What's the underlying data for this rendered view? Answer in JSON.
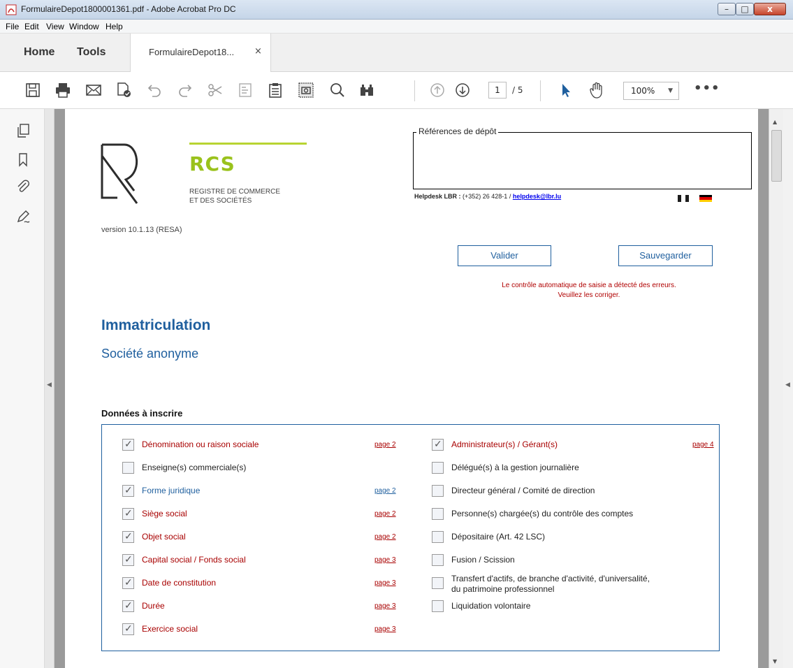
{
  "window": {
    "title": "FormulaireDepot1800001361.pdf - Adobe Acrobat Pro DC",
    "controls": {
      "minimize": "–",
      "maximize": "□",
      "close": "x"
    }
  },
  "menu": {
    "file": "File",
    "edit": "Edit",
    "view": "View",
    "window": "Window",
    "help": "Help"
  },
  "tabs": {
    "home": "Home",
    "tools": "Tools",
    "document": "FormulaireDepot18...",
    "close": "×"
  },
  "toolbar": {
    "icons": [
      "save-icon",
      "print-icon",
      "email-icon",
      "sign-file-icon",
      "undo-icon",
      "redo-icon",
      "cut-icon",
      "text-select-icon",
      "clipboard-icon",
      "snapshot-icon",
      "search-icon",
      "find-icon",
      "page-up-icon",
      "page-down-icon",
      "pointer-icon",
      "hand-icon"
    ],
    "current_page": "1",
    "total_pages": "/ 5",
    "zoom": "100%",
    "zoom_chevron": "▼",
    "more": "•••"
  },
  "left_panel": {
    "icons": [
      "pages-icon",
      "bookmark-icon",
      "attachment-icon",
      "signature-icon"
    ],
    "collapse": "◀"
  },
  "right_panel": {
    "collapse": "◀",
    "scroll_up": "▲",
    "scroll_down": "▼"
  },
  "form": {
    "logo": {
      "name": "RCS",
      "subtitle_line1": "REGISTRE DE COMMERCE",
      "subtitle_line2": "ET DES SOCIÉTÉS"
    },
    "version": "version 10.1.13 (RESA)",
    "references_label": "Références de dépôt",
    "helpdesk_label": "Helpdesk LBR :",
    "helpdesk_phone": " (+352) 26 428-1 / ",
    "helpdesk_email": "helpdesk@lbr.lu",
    "buttons": {
      "validate": "Valider",
      "save": "Sauvegarder"
    },
    "error_line1": "Le contrôle automatique de saisie a détecté des erreurs.",
    "error_line2": "Veuillez les corriger.",
    "title": "Immatriculation",
    "subtitle": "Société anonyme",
    "section_title": "Données à inscrire",
    "left_items": [
      {
        "label": "Dénomination ou raison sociale",
        "checked": true,
        "link": "page 2",
        "color": "red"
      },
      {
        "label": "Enseigne(s) commerciale(s)",
        "checked": false,
        "link": "",
        "color": "black"
      },
      {
        "label": "Forme juridique",
        "checked": true,
        "link": "page 2",
        "color": "blue"
      },
      {
        "label": "Siège social",
        "checked": true,
        "link": "page 2",
        "color": "red"
      },
      {
        "label": "Objet social",
        "checked": true,
        "link": "page 2",
        "color": "red"
      },
      {
        "label": "Capital social / Fonds social",
        "checked": true,
        "link": "page 3",
        "color": "red"
      },
      {
        "label": "Date de constitution",
        "checked": true,
        "link": "page 3",
        "color": "red"
      },
      {
        "label": "Durée",
        "checked": true,
        "link": "page 3",
        "color": "red"
      },
      {
        "label": "Exercice social",
        "checked": true,
        "link": "page 3",
        "color": "red"
      }
    ],
    "right_items": [
      {
        "label": "Administrateur(s) / Gérant(s)",
        "checked": true,
        "link": "page 4",
        "color": "red"
      },
      {
        "label": "Délégué(s) à la gestion journalière",
        "checked": false,
        "link": "",
        "color": "black"
      },
      {
        "label": "Directeur général / Comité de direction",
        "checked": false,
        "link": "",
        "color": "black"
      },
      {
        "label": "Personne(s) chargée(s) du contrôle des comptes",
        "checked": false,
        "link": "",
        "color": "black"
      },
      {
        "label": "Dépositaire (Art. 42 LSC)",
        "checked": false,
        "link": "",
        "color": "black"
      },
      {
        "label": "Fusion / Scission",
        "checked": false,
        "link": "",
        "color": "black"
      },
      {
        "label": "Transfert d'actifs, de branche d'activité, d'universalité,",
        "label2": "du patrimoine professionnel",
        "checked": false,
        "link": "",
        "color": "black"
      },
      {
        "label": "Liquidation volontaire",
        "checked": false,
        "link": "",
        "color": "black"
      }
    ]
  },
  "colors": {
    "form_blue": "#1f5f9e",
    "error_red": "#a80000",
    "logo_green": "#9ac21c"
  }
}
